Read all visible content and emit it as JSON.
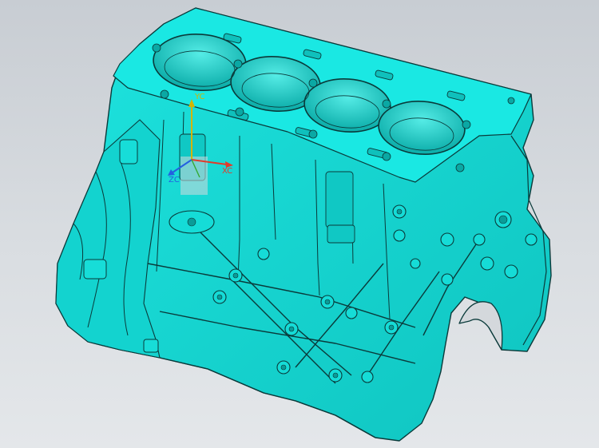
{
  "viewport": {
    "background_color": "#d4d8dc",
    "model": {
      "name": "engine-cylinder-block",
      "fill_color": "#12d6d2",
      "edge_color": "#0a3a3a",
      "cylinder_bores": 4
    },
    "triad": {
      "x_label": "XC",
      "y_label": "YC",
      "z_label": "ZC",
      "x_color": "#e23a2a",
      "y_color": "#d4b400",
      "z_color": "#2460e0"
    }
  }
}
